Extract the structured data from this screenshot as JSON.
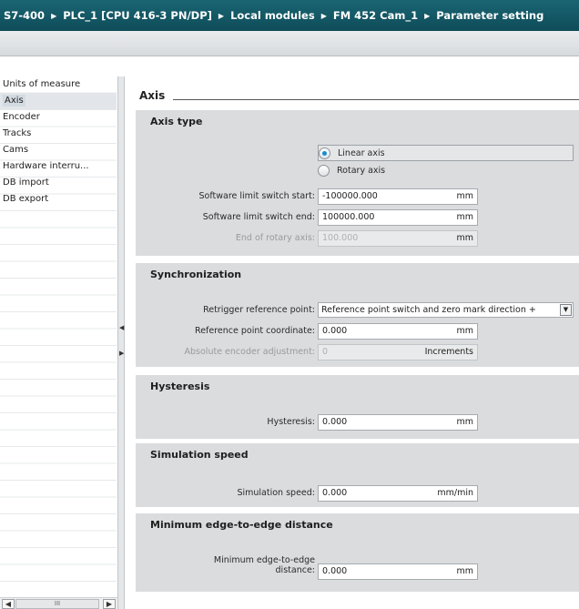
{
  "breadcrumb": [
    "S7-400",
    "PLC_1 [CPU 416-3 PN/DP]",
    "Local modules",
    "FM 452 Cam_1",
    "Parameter setting"
  ],
  "nav": {
    "items": [
      "Units of measure",
      "Axis",
      "Encoder",
      "Tracks",
      "Cams",
      "Hardware interru...",
      "DB import",
      "DB export"
    ],
    "selected": "Axis",
    "scroll_thumb_glyph": "III"
  },
  "page": {
    "heading": "Axis"
  },
  "axis_type": {
    "title": "Axis type",
    "linear_label": "Linear axis",
    "rotary_label": "Rotary axis",
    "selected": "Linear axis",
    "sw_start_label": "Software limit switch start:",
    "sw_start_value": "-100000.000",
    "sw_end_label": "Software limit switch end:",
    "sw_end_value": "100000.000",
    "end_rotary_label": "End of rotary axis:",
    "end_rotary_value": "100.000",
    "unit": "mm"
  },
  "synchronization": {
    "title": "Synchronization",
    "retrigger_label": "Retrigger reference point:",
    "retrigger_value": "Reference point switch and zero mark direction +",
    "coord_label": "Reference point coordinate:",
    "coord_value": "0.000",
    "coord_unit": "mm",
    "abs_label": "Absolute encoder adjustment:",
    "abs_value": "0",
    "abs_unit": "Increments"
  },
  "hysteresis": {
    "title": "Hysteresis",
    "label": "Hysteresis:",
    "value": "0.000",
    "unit": "mm"
  },
  "simulation": {
    "title": "Simulation speed",
    "label": "Simulation speed:",
    "value": "0.000",
    "unit": "mm/min"
  },
  "min_edge": {
    "title": "Minimum edge-to-edge distance",
    "label_line1": "Minimum edge-to-edge",
    "label_line2": "distance:",
    "value": "0.000",
    "unit": "mm"
  },
  "colors": {
    "title_bar": "#0f4c59",
    "section_bg": "#dadcdd",
    "radio_accent": "#1a8bd0"
  }
}
